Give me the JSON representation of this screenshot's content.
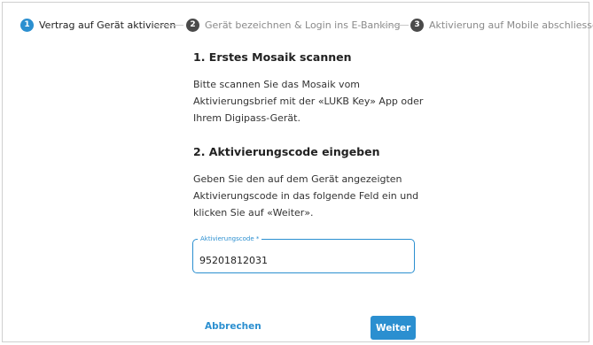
{
  "stepper": {
    "steps": [
      {
        "number": "1",
        "label": "Vertrag auf Gerät aktivieren",
        "state": "active"
      },
      {
        "number": "2",
        "label": "Gerät bezeichnen & Login ins E-Banking",
        "state": "inactive"
      },
      {
        "number": "3",
        "label": "Aktivierung auf Mobile abschliessen",
        "state": "inactive"
      }
    ]
  },
  "section1": {
    "title": "1. Erstes Mosaik scannen",
    "text": "Bitte scannen Sie das Mosaik vom Aktivierungsbrief mit der «LUKB Key» App oder Ihrem Digipass-Gerät."
  },
  "section2": {
    "title": "2. Aktivierungscode eingeben",
    "text": "Geben Sie den auf dem Gerät angezeigten Aktivierungscode in das folgende Feld ein und klicken Sie auf «Weiter»."
  },
  "activation_field": {
    "label": "Aktivierungscode *",
    "value": "95201812031"
  },
  "actions": {
    "cancel_label": "Abbrechen",
    "next_label": "Weiter"
  },
  "colors": {
    "accent": "#2b8fd0",
    "inactive_step": "#4a4a4a"
  }
}
